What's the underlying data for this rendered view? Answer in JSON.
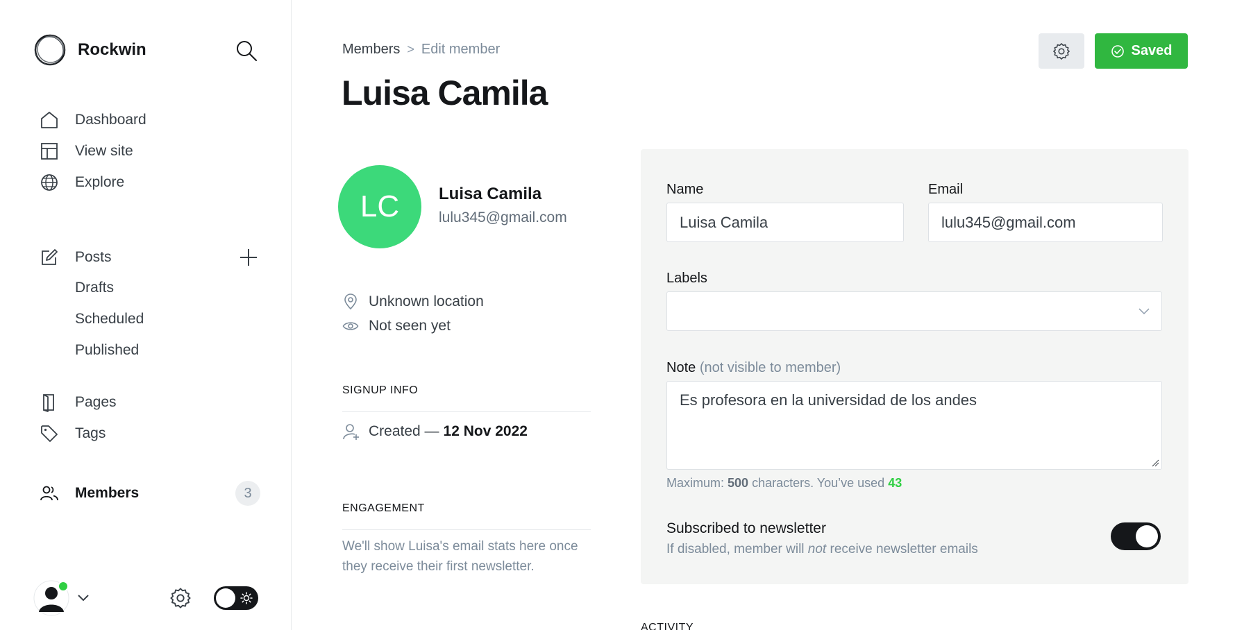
{
  "brand": {
    "name": "Rockwin"
  },
  "sidebar": {
    "nav_primary": [
      {
        "label": "Dashboard",
        "icon": "home-icon"
      },
      {
        "label": "View site",
        "icon": "layout-icon"
      },
      {
        "label": "Explore",
        "icon": "globe-icon"
      }
    ],
    "posts": {
      "label": "Posts",
      "icon": "edit-icon"
    },
    "post_subitems": [
      {
        "label": "Drafts"
      },
      {
        "label": "Scheduled"
      },
      {
        "label": "Published"
      }
    ],
    "nav_secondary": [
      {
        "label": "Pages",
        "icon": "page-icon"
      },
      {
        "label": "Tags",
        "icon": "tag-icon"
      },
      {
        "label": "Members",
        "icon": "members-icon",
        "active": true,
        "count": "3"
      }
    ]
  },
  "header": {
    "breadcrumb": {
      "parent": "Members",
      "separator": ">",
      "current": "Edit member"
    },
    "title": "Luisa Camila",
    "saved_label": "Saved"
  },
  "member": {
    "initials": "LC",
    "name": "Luisa Camila",
    "email": "lulu345@gmail.com",
    "location": "Unknown location",
    "last_seen": "Not seen yet",
    "avatar_color": "#3cd97a"
  },
  "signup": {
    "heading": "SIGNUP INFO",
    "created_label": "Created —",
    "created_date": "12 Nov 2022"
  },
  "engagement": {
    "heading": "ENGAGEMENT",
    "text": "We'll show Luisa's email stats here once they receive their first newsletter."
  },
  "form": {
    "name_label": "Name",
    "name_value": "Luisa Camila",
    "email_label": "Email",
    "email_value": "lulu345@gmail.com",
    "labels_label": "Labels",
    "labels_value": "",
    "note_label": "Note",
    "note_hint": "(not visible to member)",
    "note_value": "Es profesora en la universidad de los andes",
    "char_prefix": "Maximum: ",
    "char_max": "500",
    "char_middle": " characters. You’ve used ",
    "char_used": "43",
    "newsletter_title": "Subscribed to newsletter",
    "newsletter_desc_before": "If disabled, member will ",
    "newsletter_desc_em": "not",
    "newsletter_desc_after": " receive newsletter emails",
    "newsletter_enabled": true
  },
  "activity": {
    "heading": "ACTIVITY"
  },
  "colors": {
    "accent_green": "#30b740",
    "online": "#30cf43",
    "dark": "#15171a"
  }
}
